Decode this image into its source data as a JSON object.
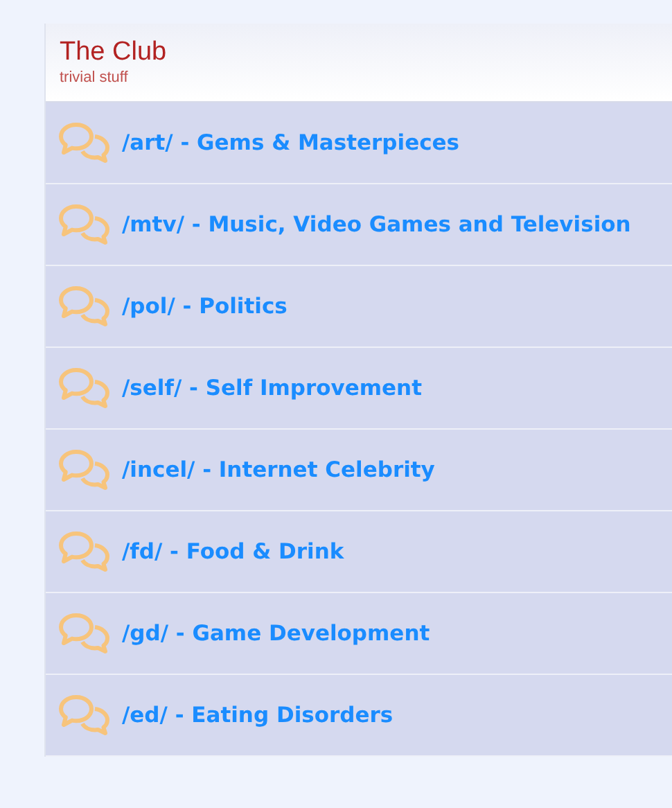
{
  "header": {
    "title": "The Club",
    "subtitle": "trivial stuff"
  },
  "boards": [
    {
      "label": "/art/ - Gems & Masterpieces"
    },
    {
      "label": "/mtv/ - Music, Video Games and Television"
    },
    {
      "label": "/pol/ - Politics"
    },
    {
      "label": "/self/ - Self Improvement"
    },
    {
      "label": "/incel/ - Internet Celebrity"
    },
    {
      "label": "/fd/ - Food & Drink"
    },
    {
      "label": "/gd/ - Game Development"
    },
    {
      "label": "/ed/ - Eating Disorders"
    }
  ]
}
